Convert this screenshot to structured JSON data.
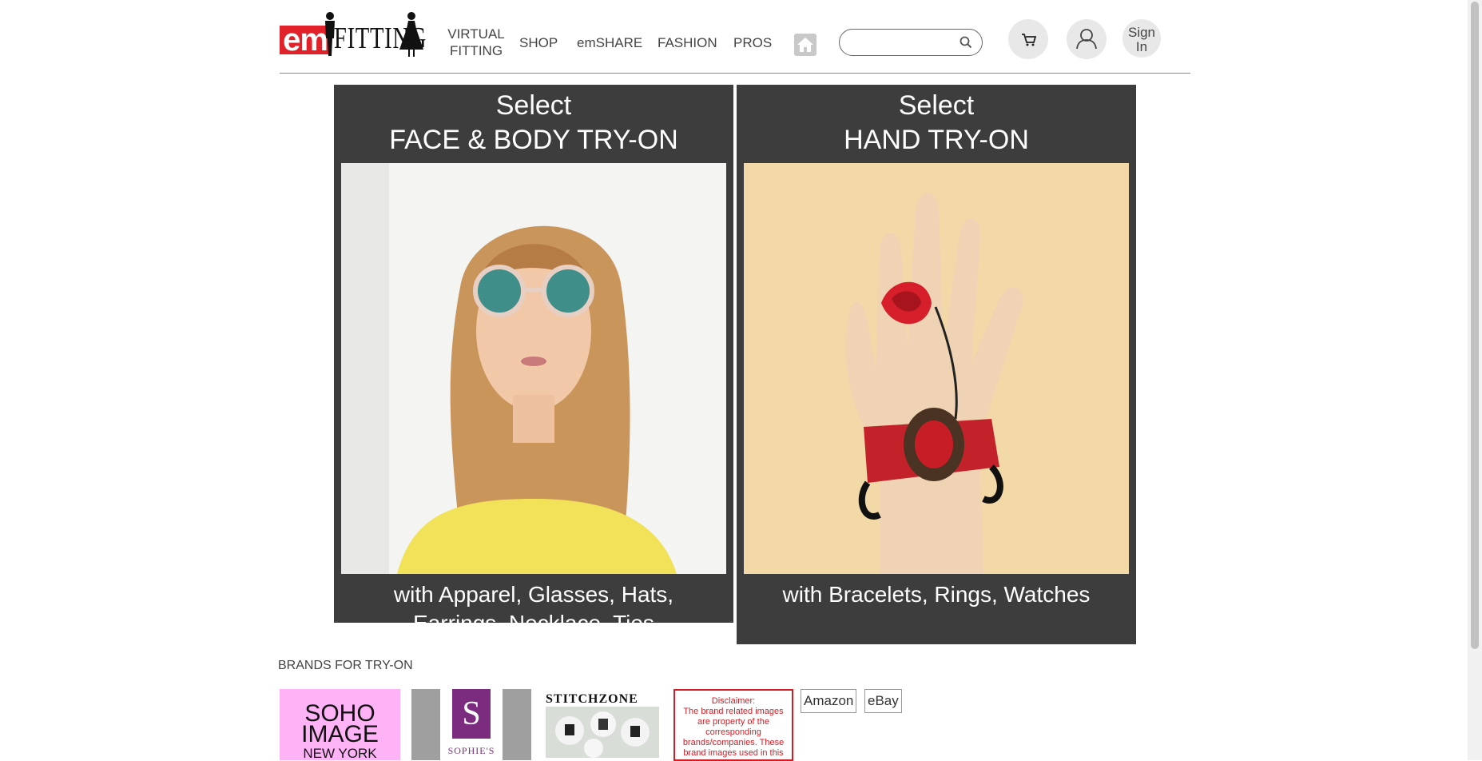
{
  "header": {
    "logo_text": {
      "em": "em",
      "fitting": "FITTING"
    },
    "nav": {
      "virtual_line1": "VIRTUAL",
      "virtual_line2": "FITTING",
      "shop": "SHOP",
      "emshare": "emSHARE",
      "fashion": "FASHION",
      "pros": "PROS"
    },
    "search": {
      "value": "",
      "placeholder": ""
    },
    "signin_line1": "Sign",
    "signin_line2": "In"
  },
  "panels": {
    "face": {
      "title_line1": "Select",
      "title_line2": "FACE & BODY TRY-ON",
      "subtitle_line1": "with Apparel, Glasses, Hats,",
      "subtitle_line2": "Earrings, Necklace, Ties"
    },
    "hand": {
      "title_line1": "Select",
      "title_line2": "HAND TRY-ON",
      "subtitle": "with  Bracelets, Rings, Watches"
    }
  },
  "brands": {
    "label": "BRANDS FOR TRY-ON",
    "soho": {
      "line1": "SOHO",
      "line2": "IMAGE",
      "line3": "NEW YORK"
    },
    "sophie": {
      "letter": "S",
      "name": "SOPHIE'S"
    },
    "stitchzone": {
      "name": "STITCHZONE"
    },
    "disclaimer": {
      "title": "Disclaimer:",
      "text": "The brand related images are property of the corresponding brands/companies. These brand images used in this web site are for demo/design draft only."
    },
    "amazon": "Amazon",
    "ebay": "eBay"
  },
  "colors": {
    "brand_red": "#e2222a",
    "panel_bg": "#3d3d3d",
    "soho_pink": "#ffb3f7",
    "sophie_purple": "#7b2c7f"
  }
}
